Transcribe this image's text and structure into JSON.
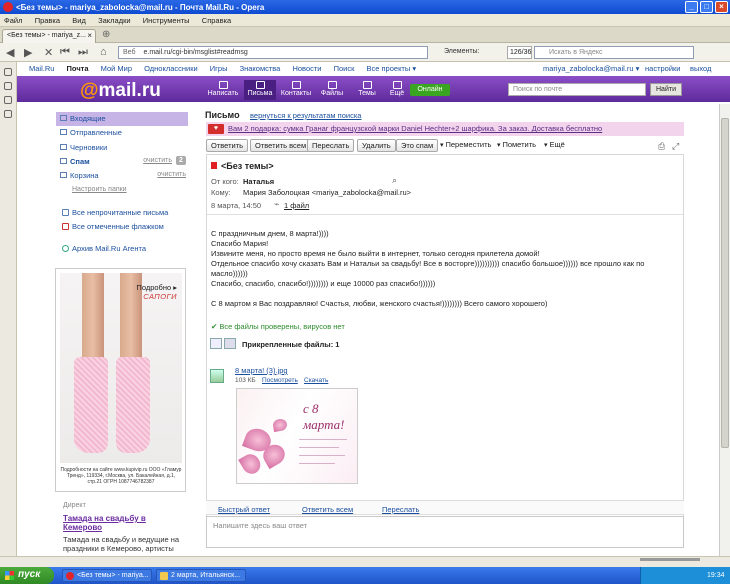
{
  "window": {
    "title": "<Без темы> - mariya_zabolocka@mail.ru - Почта Mail.Ru - Opera"
  },
  "menubar": [
    "Файл",
    "Правка",
    "Вид",
    "Закладки",
    "Инструменты",
    "Справка"
  ],
  "browser": {
    "tab_title": "<Без темы> - mariya_z...",
    "url_prefix": "Веб",
    "url": "e.mail.ru/cgi-bin/msglist#readmsg",
    "elements_label": "Элементы:",
    "elements_count": "126/36",
    "search_placeholder": "Искать в Яндекс"
  },
  "topnav": {
    "links": [
      "Mail.Ru",
      "Почта",
      "Мой Мир",
      "Одноклассники",
      "Игры",
      "Знакомства",
      "Новости",
      "Поиск",
      "Все проекты ▾"
    ],
    "user": "mariya_zabolocka@mail.ru ▾",
    "settings": "настройки",
    "logout": "выход"
  },
  "header": {
    "logo_at": "@",
    "logo_text": "mail.ru",
    "buttons": [
      "Написать",
      "Письма",
      "Контакты",
      "Файлы",
      "Темы",
      "Ещё"
    ],
    "online": "Онлайн",
    "search_placeholder": "Поиск по почте",
    "find": "Найти"
  },
  "folders": [
    {
      "label": "Входящие"
    },
    {
      "label": "Отправленные"
    },
    {
      "label": "Черновики"
    },
    {
      "label": "Спам",
      "action": "очистить",
      "badge": "2"
    },
    {
      "label": "Корзина",
      "action": "очистить"
    }
  ],
  "folder_settings": "Настроить папки",
  "side_links": [
    "Все непрочитанные письма",
    "Все отмеченные флажком",
    "Архив Mail.Ru Агента"
  ],
  "ad": {
    "title": "Подробно ▸",
    "subtitle": "САПОГИ",
    "small": "Подробности на сайте www.kupivip.ru ООО «Гламур Тренд», 119334, г.Москва, ул. Бакалейная, д.1, стр.21 ОГРН 1087746782387",
    "direct_label": "Директ",
    "link": "Тамада на свадьбу в Кемерово",
    "text": "Тамада на свадьбу и ведущие на праздники в Кемерово, артисты"
  },
  "letter": {
    "section_title": "Письмо",
    "back_link": "вернуться к результатам поиска",
    "promo": "Вам 2 подарка: сумка Гранаг французской марки Daniel Hechter+2 шарфика. За заказ. Доставка бесплатно",
    "promo_icon": "♥",
    "toolbar": [
      "Ответить",
      "Ответить всем",
      "Переслать",
      "Удалить",
      "Это спам"
    ],
    "toolbar_dropdowns": [
      "Переместить",
      "Пометить",
      "Ещё"
    ],
    "subject": "<Без темы>",
    "from_label": "От кого:",
    "from": "Наталья",
    "to_label": "Кому:",
    "to": "Мария Заболоцкая <mariya_zabolocka@mail.ru>",
    "date": "8 марта, 14:50",
    "files_link": "1 файл",
    "body": [
      "С праздничным днем, 8 марта!))))",
      "Спасибо Мария!",
      "Извините меня, но просто время не было выйти в интернет, только сегодня прилетела домой!",
      "Отдельное спасибо хочу сказать Вам и Натальи за свадьбу! Все в восторге)))))))))) спасибо большое)))))) все прошло как по масло))))))",
      "Спасибо, спасибо, спасибо!)))))))) и еще 10000 раз спасибо!))))))",
      "",
      "С 8 мартом я Вас поздравляю! Счастья, любви, женского счастья!)))))))) Всего самого хорошего)"
    ],
    "virus_ok": "Все файлы проверены, вирусов нет",
    "attachments_title": "Прикрепленные файлы: 1",
    "file": {
      "name": "8 марта! (3).jpg",
      "size": "103 КБ",
      "view": "Посмотреть",
      "download": "Скачать"
    },
    "card_text": "с 8 марта!",
    "reply_actions": [
      "Быстрый ответ",
      "Ответить всем",
      "Переслать"
    ],
    "quick_reply_placeholder": "Напишите здесь ваш ответ"
  },
  "taskbar": {
    "start": "пуск",
    "items": [
      "<Без темы> - mariya...",
      "2 марта, Итальянск..."
    ],
    "clock": "19:34"
  }
}
